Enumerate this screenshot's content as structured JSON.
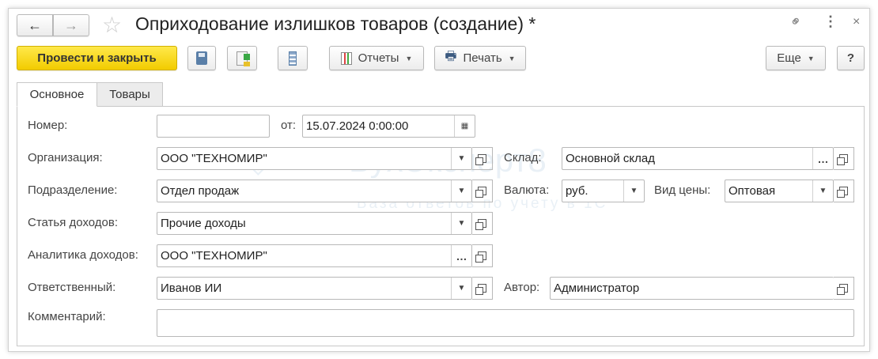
{
  "header": {
    "title": "Оприходование излишков товаров (создание) *"
  },
  "toolbar": {
    "post_close": "Провести и закрыть",
    "reports": "Отчеты",
    "print": "Печать",
    "more": "Еще",
    "help": "?"
  },
  "tabs": [
    {
      "label": "Основное",
      "active": true
    },
    {
      "label": "Товары",
      "active": false
    }
  ],
  "form": {
    "number": {
      "label": "Номер:",
      "value": ""
    },
    "date": {
      "label": "от:",
      "value": "15.07.2024  0:00:00"
    },
    "organization": {
      "label": "Организация:",
      "value": "ООО \"ТЕХНОМИР\""
    },
    "warehouse": {
      "label": "Склад:",
      "value": "Основной склад"
    },
    "department": {
      "label": "Подразделение:",
      "value": "Отдел продаж"
    },
    "currency": {
      "label": "Валюта:",
      "value": "руб."
    },
    "price_type": {
      "label": "Вид цены:",
      "value": "Оптовая"
    },
    "income_item": {
      "label": "Статья доходов:",
      "value": "Прочие доходы"
    },
    "income_analytics": {
      "label": "Аналитика доходов:",
      "value": "ООО \"ТЕХНОМИР\""
    },
    "responsible": {
      "label": "Ответственный:",
      "value": "Иванов ИИ"
    },
    "author": {
      "label": "Автор:",
      "value": "Администратор"
    },
    "comment": {
      "label": "Комментарий:",
      "value": ""
    }
  },
  "watermark": {
    "brand": "БухЭксперт8",
    "tagline": "База ответов по учету в 1С"
  }
}
